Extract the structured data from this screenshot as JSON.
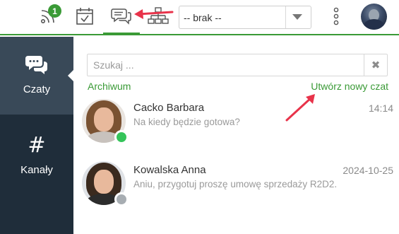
{
  "topbar": {
    "notifications_count": "1",
    "group_select": {
      "selected": "-- brak --"
    }
  },
  "sidebar": {
    "items": [
      {
        "label": "Czaty",
        "icon": "chat-bubbles-icon",
        "active": true
      },
      {
        "label": "Kanały",
        "icon": "hash-icon",
        "glyph": "#",
        "active": false
      }
    ]
  },
  "main": {
    "search": {
      "placeholder": "Szukaj ...",
      "value": "",
      "clear_icon": "✖"
    },
    "archive_label": "Archiwum",
    "new_chat_label": "Utwórz nowy czat",
    "conversations": [
      {
        "name": "Cacko Barbara",
        "time": "14:14",
        "preview": "Na kiedy będzie gotowa?",
        "status": "online",
        "status_color": "#35c45a"
      },
      {
        "name": "Kowalska Anna",
        "time": "2024-10-25",
        "preview": "Aniu, przygotuj proszę umowę sprzedaży R2D2.",
        "status": "offline",
        "status_color": "#a7adb2"
      }
    ]
  },
  "colors": {
    "accent": "#3a9a36",
    "sidebar_bg": "#1f2d3a",
    "sidebar_active_bg": "#394958",
    "annotation": "#e8334a"
  }
}
